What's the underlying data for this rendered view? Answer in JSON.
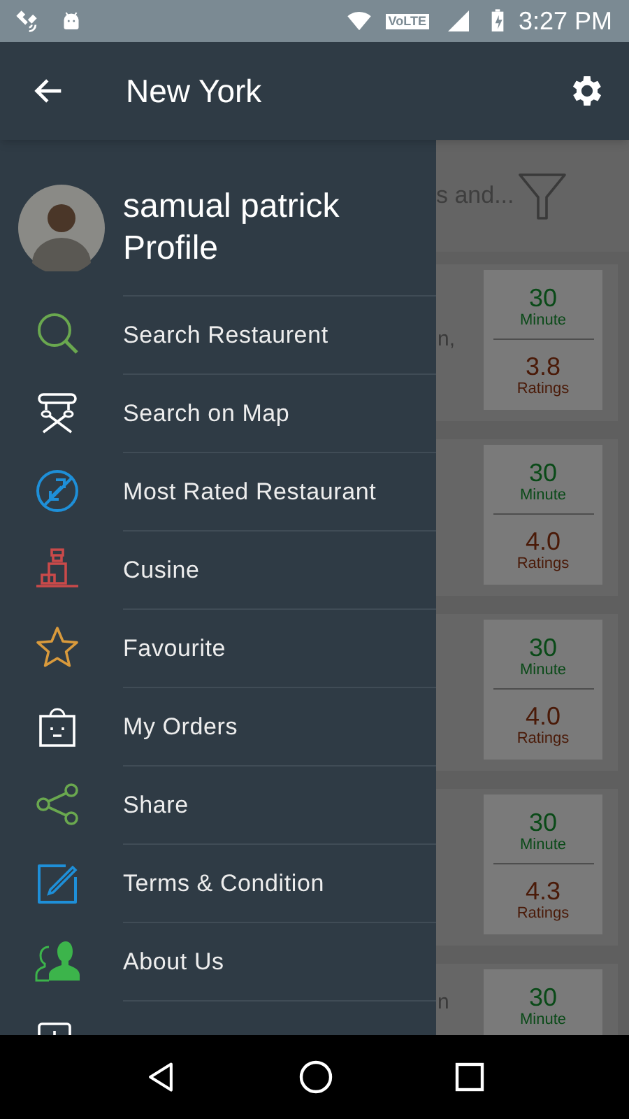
{
  "status_bar": {
    "network_badge": "VoLTE",
    "time": "3:27 PM"
  },
  "app_bar": {
    "title": "New York"
  },
  "drawer": {
    "profile": {
      "name": "samual patrick",
      "link": "Profile"
    },
    "items": [
      {
        "kind": "search",
        "label": "Search Restaurent"
      },
      {
        "kind": "map",
        "label": "Search on Map"
      },
      {
        "kind": "rated",
        "label": "Most Rated Restaurant"
      },
      {
        "kind": "cuisine",
        "label": "Cusine"
      },
      {
        "kind": "favourite",
        "label": "Favourite"
      },
      {
        "kind": "orders",
        "label": "My Orders"
      },
      {
        "kind": "share",
        "label": "Share"
      },
      {
        "kind": "terms",
        "label": "Terms & Condition"
      },
      {
        "kind": "about",
        "label": "About Us"
      },
      {
        "kind": "partial"
      }
    ]
  },
  "background": {
    "search_hint": "s and...",
    "cards": [
      {
        "fragment": "n,",
        "minutes": "30",
        "minutes_label": "Minute",
        "rating": "3.8",
        "rating_label": "Ratings"
      },
      {
        "minutes": "30",
        "minutes_label": "Minute",
        "rating": "4.0",
        "rating_label": "Ratings"
      },
      {
        "minutes": "30",
        "minutes_label": "Minute",
        "rating": "4.0",
        "rating_label": "Ratings"
      },
      {
        "minutes": "30",
        "minutes_label": "Minute",
        "rating": "4.3",
        "rating_label": "Ratings"
      },
      {
        "fragment": "n",
        "minutes": "30",
        "minutes_label": "Minute"
      }
    ]
  }
}
